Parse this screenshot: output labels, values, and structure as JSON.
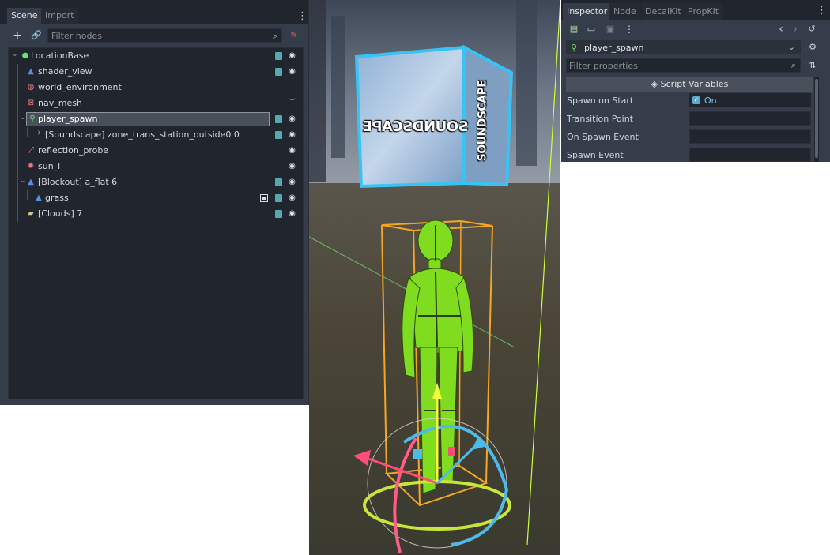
{
  "scene_panel": {
    "tabs": [
      "Scene",
      "Import"
    ],
    "filter_placeholder": "Filter nodes",
    "tree": [
      {
        "label": "LocationBase",
        "icon": "green-dot-icon"
      },
      {
        "label": "shader_view",
        "icon": "mesh-icon"
      },
      {
        "label": "world_environment",
        "icon": "globe-icon"
      },
      {
        "label": "nav_mesh",
        "icon": "navmesh-icon"
      },
      {
        "label": "player_spawn",
        "icon": "spawn-figure-icon"
      },
      {
        "label": "[Soundscape] zone_trans_station_outside0 0",
        "icon": "audio-icon"
      },
      {
        "label": "reflection_probe",
        "icon": "probe-icon"
      },
      {
        "label": "sun_l",
        "icon": "sun-icon"
      },
      {
        "label": "[Blockout] a_flat 6",
        "icon": "mesh-icon"
      },
      {
        "label": "grass",
        "icon": "mesh-icon"
      },
      {
        "label": "[Clouds] 7",
        "icon": "clouds-icon"
      }
    ]
  },
  "viewport": {
    "cube_text_front": "SOUNDSCAPE",
    "cube_text_side": "SOUNDSCAPE"
  },
  "inspector": {
    "tabs": [
      "Inspector",
      "Node",
      "DecalKit",
      "PropKit"
    ],
    "node_name": "player_spawn",
    "filter_placeholder": "Filter properties",
    "section_title": "Script Variables",
    "properties": [
      {
        "label": "Spawn on Start",
        "value": "On"
      },
      {
        "label": "Transition Point",
        "value": ""
      },
      {
        "label": "On Spawn Event",
        "value": ""
      },
      {
        "label": "Spawn Event",
        "value": ""
      }
    ]
  },
  "colors": {
    "panel_bg": "#363d4a",
    "tree_bg": "#21262e",
    "accent": "#5fa8c7",
    "script_icon": "#57a7b5",
    "gizmo_orange": "#f5a623",
    "figure_green": "#7fdc1e"
  }
}
